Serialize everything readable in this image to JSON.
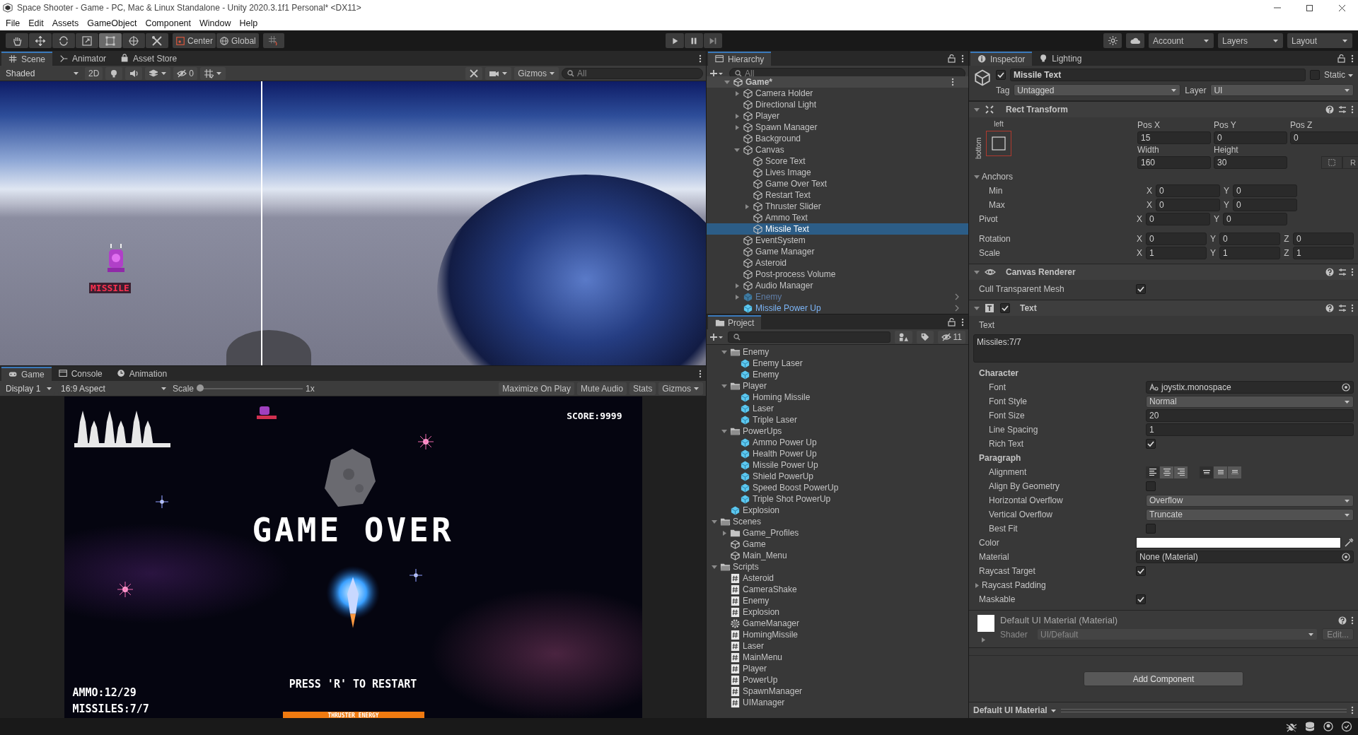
{
  "window": {
    "title": "Space Shooter - Game - PC, Mac & Linux Standalone - Unity 2020.3.1f1 Personal* <DX11>"
  },
  "menu": [
    "File",
    "Edit",
    "Assets",
    "GameObject",
    "Component",
    "Window",
    "Help"
  ],
  "toolbar": {
    "tools": [
      {
        "kind": "hand",
        "selected": false
      },
      {
        "kind": "move",
        "selected": false
      },
      {
        "kind": "rotate",
        "selected": false
      },
      {
        "kind": "scale",
        "selected": false
      },
      {
        "kind": "rect",
        "selected": true
      },
      {
        "kind": "transform",
        "selected": false
      },
      {
        "kind": "custom",
        "selected": false
      }
    ],
    "pivot": "Center",
    "space": "Global",
    "account": "Account",
    "layers": "Layers",
    "layout": "Layout"
  },
  "scene_panel": {
    "tabs": [
      {
        "label": "Scene",
        "selected": true
      },
      {
        "label": "Animator",
        "selected": false
      },
      {
        "label": "Asset Store",
        "selected": false
      }
    ],
    "shading": "Shaded",
    "mode_2d": "2D",
    "toggles": [
      {
        "kind": "lighting",
        "on": false
      },
      {
        "kind": "audio",
        "on": false
      },
      {
        "kind": "effects",
        "on": false
      }
    ],
    "grid_on": false,
    "hidden_count": "0",
    "gizmos": "Gizmos",
    "search_placeholder": "All",
    "sprite_label": "MISSILE"
  },
  "game_panel": {
    "tabs": [
      {
        "label": "Game",
        "selected": true
      },
      {
        "label": "Console",
        "selected": false
      },
      {
        "label": "Animation",
        "selected": false
      }
    ],
    "display": "Display 1",
    "aspect": "16:9 Aspect",
    "scale_label": "Scale",
    "scale": {
      "level": 0
    },
    "scale_value": "1x",
    "toggles": [
      {
        "label": "Maximize On Play",
        "on": false
      },
      {
        "label": "Mute Audio",
        "on": false
      },
      {
        "label": "Stats",
        "on": false
      }
    ],
    "gizmos": "Gizmos",
    "hud": {
      "score": "SCORE:9999",
      "title": "GAME OVER",
      "restart": "PRESS 'R' TO RESTART",
      "ammo": "AMMO:12/29",
      "missiles": "MISSILES:7/7",
      "thruster": "THRUSTER ENERGY",
      "thruster_bar": {
        "level": 1
      }
    }
  },
  "hierarchy": {
    "tab": {
      "label": "Hierarchy",
      "selected": true
    },
    "search_placeholder": "All",
    "items": [
      {
        "label": "Game*",
        "kind": "scene",
        "expanded": true,
        "selected": false,
        "children": [
          {
            "label": "Camera Holder",
            "kind": "object",
            "expanded": false,
            "selected": false
          },
          {
            "label": "Directional Light",
            "kind": "object",
            "selected": false
          },
          {
            "label": "Player",
            "kind": "object",
            "expanded": false,
            "selected": false
          },
          {
            "label": "Spawn Manager",
            "kind": "object",
            "expanded": false,
            "selected": false
          },
          {
            "label": "Background",
            "kind": "object",
            "selected": false
          },
          {
            "label": "Canvas",
            "kind": "object",
            "expanded": true,
            "selected": false,
            "children": [
              {
                "label": "Score Text",
                "kind": "object",
                "selected": false
              },
              {
                "label": "Lives Image",
                "kind": "object",
                "selected": false
              },
              {
                "label": "Game Over Text",
                "kind": "object",
                "selected": false
              },
              {
                "label": "Restart Text",
                "kind": "object",
                "selected": false
              },
              {
                "label": "Thruster Slider",
                "kind": "object",
                "expanded": false,
                "selected": false
              },
              {
                "label": "Ammo Text",
                "kind": "object",
                "selected": false
              },
              {
                "label": "Missile Text",
                "kind": "object",
                "selected": true
              }
            ]
          },
          {
            "label": "EventSystem",
            "kind": "object",
            "selected": false
          },
          {
            "label": "Game Manager",
            "kind": "object",
            "selected": false
          },
          {
            "label": "Asteroid",
            "kind": "object",
            "selected": false
          },
          {
            "label": "Post-process Volume",
            "kind": "object",
            "selected": false
          },
          {
            "label": "Audio Manager",
            "kind": "object",
            "expanded": false,
            "selected": false
          },
          {
            "label": "Enemy",
            "kind": "prefab",
            "active": false,
            "expanded": false,
            "selected": false
          },
          {
            "label": "Missile Power Up",
            "kind": "prefab",
            "active": true,
            "selected": false
          }
        ]
      }
    ]
  },
  "project": {
    "tab": {
      "label": "Project",
      "selected": true
    },
    "hidden_count": "11",
    "items": [
      {
        "kind": "continued",
        "children": [
          {
            "label": "Enemy",
            "kind": "folder",
            "expanded": true,
            "selected": false,
            "children": [
              {
                "label": "Enemy Laser",
                "kind": "prefab",
                "selected": false
              },
              {
                "label": "Enemy",
                "kind": "prefab",
                "selected": false
              }
            ]
          },
          {
            "label": "Player",
            "kind": "folder",
            "expanded": true,
            "selected": false,
            "children": [
              {
                "label": "Homing Missile",
                "kind": "prefab",
                "selected": false
              },
              {
                "label": "Laser",
                "kind": "prefab",
                "selected": false
              },
              {
                "label": "Triple Laser",
                "kind": "prefab",
                "selected": false
              }
            ]
          },
          {
            "label": "PowerUps",
            "kind": "folder",
            "expanded": true,
            "selected": false,
            "children": [
              {
                "label": "Ammo Power Up",
                "kind": "prefab",
                "selected": false
              },
              {
                "label": "Health Power Up",
                "kind": "prefab",
                "selected": false
              },
              {
                "label": "Missile Power Up",
                "kind": "prefab",
                "selected": false
              },
              {
                "label": "Shield PowerUp",
                "kind": "prefab",
                "selected": false
              },
              {
                "label": "Speed Boost PowerUp",
                "kind": "prefab",
                "selected": false
              },
              {
                "label": "Triple Shot PowerUp",
                "kind": "prefab",
                "selected": false
              }
            ]
          },
          {
            "label": "Explosion",
            "kind": "prefab",
            "selected": false
          }
        ]
      },
      {
        "label": "Scenes",
        "kind": "folder",
        "expanded": true,
        "selected": false,
        "children": [
          {
            "label": "Game_Profiles",
            "kind": "folder",
            "expanded": false,
            "selected": false
          },
          {
            "label": "Game",
            "kind": "scene",
            "selected": false
          },
          {
            "label": "Main_Menu",
            "kind": "scene",
            "selected": false
          }
        ]
      },
      {
        "label": "Scripts",
        "kind": "folder",
        "expanded": true,
        "selected": false,
        "children": [
          {
            "label": "Asteroid",
            "kind": "script",
            "selected": false
          },
          {
            "label": "CameraShake",
            "kind": "script",
            "selected": false
          },
          {
            "label": "Enemy",
            "kind": "script",
            "selected": false
          },
          {
            "label": "Explosion",
            "kind": "script",
            "selected": false
          },
          {
            "label": "GameManager",
            "kind": "settings",
            "selected": false
          },
          {
            "label": "HomingMissile",
            "kind": "script",
            "selected": false
          },
          {
            "label": "Laser",
            "kind": "script",
            "selected": false
          },
          {
            "label": "MainMenu",
            "kind": "script",
            "selected": false
          },
          {
            "label": "Player",
            "kind": "script",
            "selected": false
          },
          {
            "label": "PowerUp",
            "kind": "script",
            "selected": false
          },
          {
            "label": "SpawnManager",
            "kind": "script",
            "selected": false
          },
          {
            "label": "UIManager",
            "kind": "script",
            "selected": false
          }
        ]
      }
    ]
  },
  "inspector": {
    "tabs": [
      {
        "label": "Inspector",
        "selected": true
      },
      {
        "label": "Lighting",
        "selected": false
      }
    ],
    "object": {
      "name": "Missile Text",
      "active": true,
      "static_label": "Static",
      "static": false,
      "tag_label": "Tag",
      "tag": "Untagged",
      "layer_label": "Layer",
      "layer": "UI"
    },
    "components": [
      {
        "kind": "rect_transform",
        "title": "Rect Transform",
        "preset_top": "left",
        "preset_side": "bottom",
        "position": [
          {
            "label": "Pos X",
            "value": "15"
          },
          {
            "label": "Pos Y",
            "value": "0"
          },
          {
            "label": "Pos Z",
            "value": "0"
          }
        ],
        "size": [
          {
            "label": "Width",
            "value": "160"
          },
          {
            "label": "Height",
            "value": "30"
          }
        ],
        "raw_button": "R",
        "rows": [
          {
            "kind": "group",
            "label": "Anchors",
            "expanded": true,
            "children": [
              {
                "kind": "vector",
                "label": "Min",
                "axes": [
                  {
                    "axis": "X",
                    "value": "0"
                  },
                  {
                    "axis": "Y",
                    "value": "0"
                  }
                ]
              },
              {
                "kind": "vector",
                "label": "Max",
                "axes": [
                  {
                    "axis": "X",
                    "value": "0"
                  },
                  {
                    "axis": "Y",
                    "value": "0"
                  }
                ]
              }
            ]
          },
          {
            "kind": "vector",
            "label": "Pivot",
            "axes": [
              {
                "axis": "X",
                "value": "0"
              },
              {
                "axis": "Y",
                "value": "0"
              }
            ]
          },
          {
            "kind": "spacer"
          },
          {
            "kind": "vector",
            "label": "Rotation",
            "axes": [
              {
                "axis": "X",
                "value": "0"
              },
              {
                "axis": "Y",
                "value": "0"
              },
              {
                "axis": "Z",
                "value": "0"
              }
            ]
          },
          {
            "kind": "vector",
            "label": "Scale",
            "axes": [
              {
                "axis": "X",
                "value": "1"
              },
              {
                "axis": "Y",
                "value": "1"
              },
              {
                "axis": "Z",
                "value": "1"
              }
            ]
          }
        ]
      },
      {
        "kind": "canvas_renderer",
        "title": "Canvas Renderer",
        "rows": [
          {
            "kind": "checkbox",
            "label": "Cull Transparent Mesh",
            "checked": true
          }
        ]
      },
      {
        "kind": "text",
        "title": "Text",
        "enabled": true,
        "rows": [
          {
            "kind": "textarea",
            "label": "Text",
            "value": "Missiles:7/7"
          },
          {
            "kind": "heading",
            "label": "Character",
            "children": [
              {
                "kind": "font",
                "label": "Font",
                "value": "joystix.monospace"
              },
              {
                "kind": "dropdown",
                "label": "Font Style",
                "value": "Normal"
              },
              {
                "kind": "field",
                "label": "Font Size",
                "value": "20"
              },
              {
                "kind": "field",
                "label": "Line Spacing",
                "value": "1"
              },
              {
                "kind": "checkbox",
                "label": "Rich Text",
                "checked": true
              }
            ]
          },
          {
            "kind": "heading",
            "label": "Paragraph",
            "children": [
              {
                "kind": "alignment",
                "label": "Alignment",
                "horizontal": [
                  {
                    "kind": "left",
                    "selected": true
                  },
                  {
                    "kind": "center",
                    "selected": false
                  },
                  {
                    "kind": "right",
                    "selected": false
                  }
                ],
                "vertical": [
                  {
                    "kind": "top",
                    "selected": true
                  },
                  {
                    "kind": "middle",
                    "selected": false
                  },
                  {
                    "kind": "bottom",
                    "selected": false
                  }
                ]
              },
              {
                "kind": "checkbox",
                "label": "Align By Geometry",
                "checked": false
              },
              {
                "kind": "dropdown",
                "label": "Horizontal Overflow",
                "value": "Overflow"
              },
              {
                "kind": "dropdown",
                "label": "Vertical Overflow",
                "value": "Truncate"
              },
              {
                "kind": "checkbox",
                "label": "Best Fit",
                "checked": false
              }
            ]
          },
          {
            "kind": "color",
            "label": "Color",
            "color": "#ffffff"
          },
          {
            "kind": "object",
            "label": "Material",
            "value": "None (Material)"
          },
          {
            "kind": "checkbox",
            "label": "Raycast Target",
            "checked": true
          },
          {
            "kind": "group",
            "label": "Raycast Padding",
            "expanded": false
          },
          {
            "kind": "checkbox",
            "label": "Maskable",
            "checked": true
          }
        ]
      },
      {
        "kind": "material",
        "title": "Default UI Material (Material)",
        "shader_label": "Shader",
        "shader": "UI/Default",
        "edit": "Edit..."
      }
    ],
    "add_component": "Add Component",
    "preview": "Default UI Material"
  }
}
